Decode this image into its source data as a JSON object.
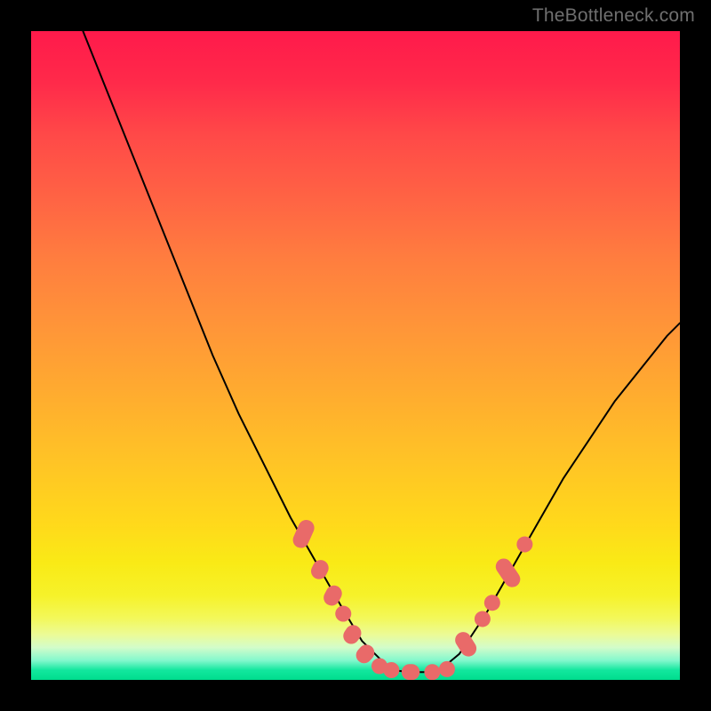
{
  "watermark": "TheBottleneck.com",
  "chart_data": {
    "type": "line",
    "title": "",
    "xlabel": "",
    "ylabel": "",
    "xlim": [
      0,
      100
    ],
    "ylim": [
      0,
      100
    ],
    "grid": false,
    "legend": false,
    "background_gradient": [
      "#ff1a4b",
      "#ff7d3f",
      "#ffd91b",
      "#00dd8d"
    ],
    "series": [
      {
        "name": "left-curve",
        "stroke": "#000000",
        "x": [
          8,
          12,
          16,
          20,
          24,
          28,
          32,
          36,
          40,
          44,
          48,
          51,
          54,
          56
        ],
        "y": [
          100,
          90,
          80,
          70,
          60,
          50,
          41,
          33,
          25,
          18,
          11,
          6,
          3,
          1.5
        ]
      },
      {
        "name": "right-curve",
        "stroke": "#000000",
        "x": [
          63,
          66,
          70,
          74,
          78,
          82,
          86,
          90,
          94,
          98,
          100
        ],
        "y": [
          1.5,
          4,
          10,
          17,
          24,
          31,
          37,
          43,
          48,
          53,
          55
        ]
      },
      {
        "name": "flat-bottom",
        "stroke": "#000000",
        "x": [
          56,
          58,
          60,
          62,
          63
        ],
        "y": [
          1.5,
          1.2,
          1.2,
          1.2,
          1.5
        ]
      }
    ],
    "markers": [
      {
        "name": "left-dash-cluster",
        "color": "#e96a69",
        "capsules": [
          {
            "cx": 42.0,
            "cy": 22.5,
            "len": 4.5,
            "angle": 66
          },
          {
            "cx": 44.5,
            "cy": 17.0,
            "len": 3.0,
            "angle": 64
          },
          {
            "cx": 46.5,
            "cy": 13.0,
            "len": 3.2,
            "angle": 62
          },
          {
            "cx": 48.0,
            "cy": 10.0,
            "len": 2.0,
            "angle": 60
          },
          {
            "cx": 49.5,
            "cy": 7.0,
            "len": 3.0,
            "angle": 56
          },
          {
            "cx": 51.5,
            "cy": 4.0,
            "len": 3.0,
            "angle": 48
          },
          {
            "cx": 53.5,
            "cy": 2.0,
            "len": 2.0,
            "angle": 32
          }
        ]
      },
      {
        "name": "bottom-dash-cluster",
        "color": "#e96a69",
        "capsules": [
          {
            "cx": 55.5,
            "cy": 1.5,
            "len": 2.4,
            "angle": 8
          },
          {
            "cx": 58.5,
            "cy": 1.2,
            "len": 2.8,
            "angle": 0
          },
          {
            "cx": 61.8,
            "cy": 1.2,
            "len": 2.4,
            "angle": 0
          },
          {
            "cx": 63.8,
            "cy": 1.8,
            "len": 1.8,
            "angle": -25
          }
        ]
      },
      {
        "name": "right-dash-cluster",
        "color": "#e96a69",
        "capsules": [
          {
            "cx": 67.0,
            "cy": 5.5,
            "len": 4.0,
            "angle": -58
          },
          {
            "cx": 69.5,
            "cy": 9.5,
            "len": 2.2,
            "angle": -58
          },
          {
            "cx": 71.0,
            "cy": 12.0,
            "len": 2.2,
            "angle": -58
          },
          {
            "cx": 73.5,
            "cy": 16.5,
            "len": 4.8,
            "angle": -56
          },
          {
            "cx": 76.0,
            "cy": 21.0,
            "len": 2.2,
            "angle": -54
          }
        ]
      }
    ]
  }
}
